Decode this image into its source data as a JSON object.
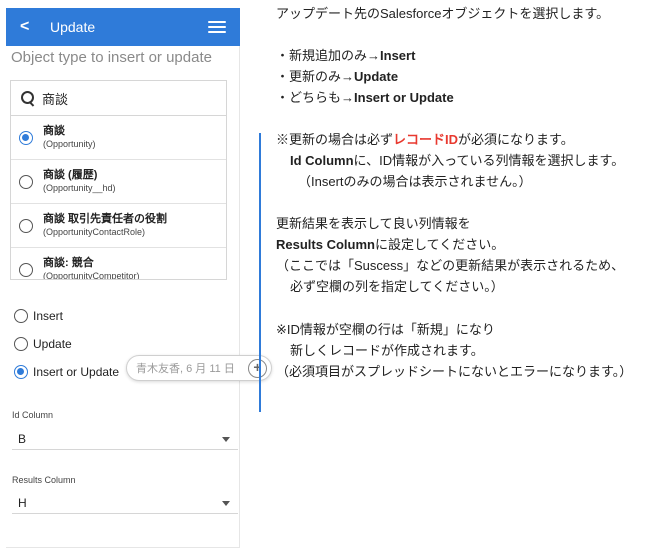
{
  "header": {
    "title": "Update"
  },
  "object_section": {
    "title": "Object type to insert or update"
  },
  "search": {
    "value": "商談"
  },
  "objects": [
    {
      "name": "商談",
      "api": "(Opportunity)",
      "selected": true
    },
    {
      "name": "商談 (履歴)",
      "api": "(Opportunity__hd)",
      "selected": false
    },
    {
      "name": "商談 取引先責任者の役割",
      "api": "(OpportunityContactRole)",
      "selected": false
    },
    {
      "name": "商談: 競合",
      "api": "(OpportunityCompetitor)",
      "selected": false
    }
  ],
  "operations": [
    {
      "label": "Insert",
      "selected": false
    },
    {
      "label": "Update",
      "selected": false
    },
    {
      "label": "Insert or Update",
      "selected": true
    }
  ],
  "comment": {
    "text": "青木友香, 6 月 11 日"
  },
  "id_column": {
    "label": "Id Column",
    "value": "B"
  },
  "results_column": {
    "label": "Results Column",
    "value": "H"
  },
  "notes": {
    "l1": "アップデート先のSalesforceオブジェクトを選択します。",
    "l2a": "・新規追加のみ→",
    "l2b": "Insert",
    "l3a": "・更新のみ→",
    "l3b": "Update",
    "l4a": "・どちらも→",
    "l4b": "Insert or Update",
    "l5a": "※更新の場合は必ず",
    "l5b": "レコードID",
    "l5c": "が必須になります。",
    "l6a": "Id Column",
    "l6b": "に、ID情報が入っている列情報を選択します。",
    "l7": "（Insertのみの場合は表示されません。）",
    "l8": "更新結果を表示して良い列情報を",
    "l9a": "Results Column",
    "l9b": "に設定してください。",
    "l10": "（ここでは「Suscess」などの更新結果が表示されるため、",
    "l11": "必ず空欄の列を指定してください。）",
    "l12": "※ID情報が空欄の行は「新規」になり",
    "l13": "新しくレコードが作成されます。",
    "l14": "（必須項目がスプレッドシートにないとエラーになります。）"
  },
  "colors": {
    "accent": "#2f7bd9",
    "highlight": "#e8392f"
  }
}
